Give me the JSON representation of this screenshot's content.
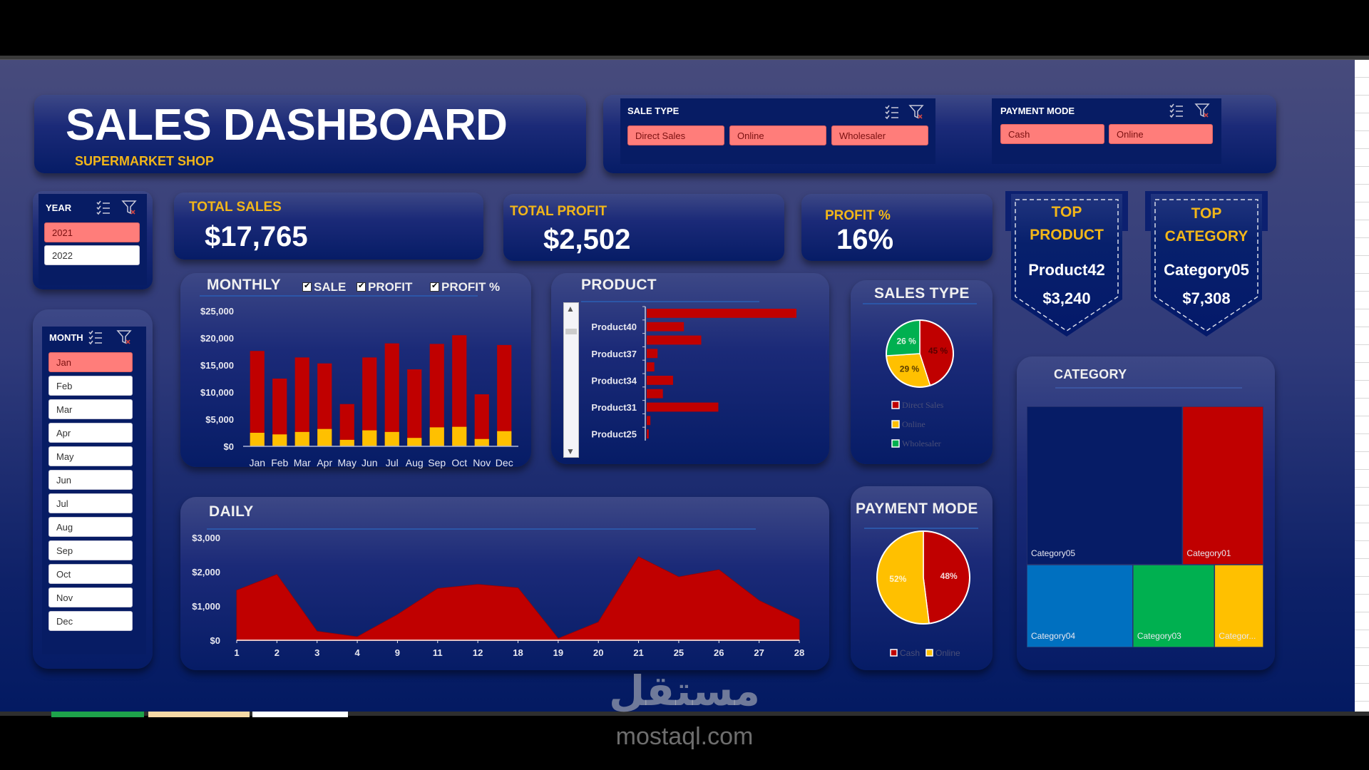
{
  "header": {
    "title": "SALES DASHBOARD",
    "subtitle": "SUPERMARKET SHOP"
  },
  "slicers": {
    "sale_type": {
      "title": "SALE TYPE",
      "items": [
        {
          "label": "Direct Sales",
          "selected": true
        },
        {
          "label": "Online",
          "selected": true
        },
        {
          "label": "Wholesaler",
          "selected": true
        }
      ]
    },
    "payment_mode": {
      "title": "PAYMENT MODE",
      "items": [
        {
          "label": "Cash",
          "selected": true
        },
        {
          "label": "Online",
          "selected": true
        }
      ]
    },
    "year": {
      "title": "YEAR",
      "items": [
        {
          "label": "2021",
          "selected": true
        },
        {
          "label": "2022",
          "selected": false
        }
      ]
    },
    "month": {
      "title": "MONTH",
      "items": [
        {
          "label": "Jan",
          "selected": true
        },
        {
          "label": "Feb",
          "selected": false
        },
        {
          "label": "Mar",
          "selected": false
        },
        {
          "label": "Apr",
          "selected": false
        },
        {
          "label": "May",
          "selected": false
        },
        {
          "label": "Jun",
          "selected": false
        },
        {
          "label": "Jul",
          "selected": false
        },
        {
          "label": "Aug",
          "selected": false
        },
        {
          "label": "Sep",
          "selected": false
        },
        {
          "label": "Oct",
          "selected": false
        },
        {
          "label": "Nov",
          "selected": false
        },
        {
          "label": "Dec",
          "selected": false
        }
      ]
    },
    "icons": {
      "multi_select": "multi-select-icon",
      "clear_filter": "clear-filter-icon"
    }
  },
  "kpis": {
    "total_sales": {
      "label": "TOTAL SALES",
      "value": "$17,765"
    },
    "total_profit": {
      "label": "TOTAL PROFIT",
      "value": "$2,502"
    },
    "profit_pct": {
      "label": "PROFIT %",
      "value": "16%"
    }
  },
  "top_product": {
    "line1": "TOP",
    "line2": "PRODUCT",
    "name": "Product42",
    "value": "$3,240"
  },
  "top_category": {
    "line1": "TOP",
    "line2": "CATEGORY",
    "name": "Category05",
    "value": "$7,308"
  },
  "monthly": {
    "title": "MONTHLY",
    "toggles": [
      {
        "label": "SALE",
        "checked": true
      },
      {
        "label": "PROFIT",
        "checked": true
      },
      {
        "label": "PROFIT %",
        "checked": true
      }
    ]
  },
  "product": {
    "title": "PRODUCT"
  },
  "sales_type": {
    "title": "SALES TYPE"
  },
  "daily": {
    "title": "DAILY"
  },
  "payment_mode": {
    "title": "PAYMENT MODE"
  },
  "category": {
    "title": "CATEGORY"
  },
  "colors": {
    "red": "#c00000",
    "yellow": "#ffc000",
    "green": "#00b050",
    "blue": "#0070c0",
    "navy": "#061c66",
    "gold_text": "#f2b619",
    "slicer_selected": "#ff7d7a"
  },
  "watermark": {
    "arabic": "مستقل",
    "site": "mostaql.com"
  },
  "chart_data": [
    {
      "id": "monthly",
      "type": "bar",
      "title": "MONTHLY",
      "categories": [
        "Jan",
        "Feb",
        "Mar",
        "Apr",
        "May",
        "Jun",
        "Jul",
        "Aug",
        "Sep",
        "Oct",
        "Nov",
        "Dec"
      ],
      "series": [
        {
          "name": "SALE",
          "color": "#c00000",
          "values": [
            17600,
            12500,
            16400,
            15300,
            7800,
            16400,
            19000,
            14200,
            18900,
            20500,
            9600,
            18700
          ]
        },
        {
          "name": "PROFIT",
          "color": "#ffc000",
          "values": [
            2500,
            2200,
            2650,
            3200,
            1200,
            2950,
            2650,
            1550,
            3500,
            3600,
            1350,
            2800
          ]
        }
      ],
      "yticks": [
        "$0",
        "$5,000",
        "$10,000",
        "$15,000",
        "$20,000",
        "$25,000"
      ],
      "ylim": [
        0,
        25000
      ],
      "grid": false
    },
    {
      "id": "product",
      "type": "bar",
      "orientation": "horizontal",
      "title": "PRODUCT",
      "categories": [
        "",
        "Product40",
        "",
        "Product37",
        "",
        "Product34",
        "",
        "Product31",
        "",
        "Product25"
      ],
      "values": [
        3240,
        805,
        1180,
        235,
        165,
        570,
        350,
        1550,
        80,
        45
      ],
      "color": "#c00000"
    },
    {
      "id": "sales_type",
      "type": "pie",
      "title": "SALES TYPE",
      "labels": [
        "Direct Sales",
        "Online",
        "Wholesaler"
      ],
      "values": [
        45,
        29,
        26
      ],
      "data_labels": [
        "45 %",
        "29 %",
        "26 %"
      ],
      "colors": [
        "#c00000",
        "#ffc000",
        "#00b050"
      ],
      "legend": "bottom"
    },
    {
      "id": "daily",
      "type": "area",
      "title": "DAILY",
      "x": [
        "1",
        "2",
        "3",
        "4",
        "9",
        "11",
        "12",
        "18",
        "19",
        "20",
        "21",
        "25",
        "26",
        "27",
        "28"
      ],
      "values": [
        1460,
        1920,
        260,
        100,
        750,
        1510,
        1630,
        1530,
        50,
        530,
        2440,
        1850,
        2060,
        1160,
        600
      ],
      "yticks": [
        "$0",
        "$1,000",
        "$2,000",
        "$3,000"
      ],
      "ylim": [
        0,
        3000
      ],
      "color": "#c00000"
    },
    {
      "id": "payment_mode",
      "type": "pie",
      "title": "PAYMENT MODE",
      "labels": [
        "Cash",
        "Online"
      ],
      "values": [
        48,
        52
      ],
      "data_labels": [
        "48%",
        "52%"
      ],
      "colors": [
        "#c00000",
        "#ffc000"
      ],
      "legend": "bottom"
    },
    {
      "id": "category",
      "type": "treemap",
      "title": "CATEGORY",
      "labels": [
        "Category05",
        "Category01",
        "Category04",
        "Category03",
        "Categor..."
      ],
      "values": [
        7308,
        3800,
        2600,
        2000,
        1200
      ],
      "colors": [
        "#061c66",
        "#c00000",
        "#0070c0",
        "#00b050",
        "#ffc000"
      ]
    }
  ]
}
